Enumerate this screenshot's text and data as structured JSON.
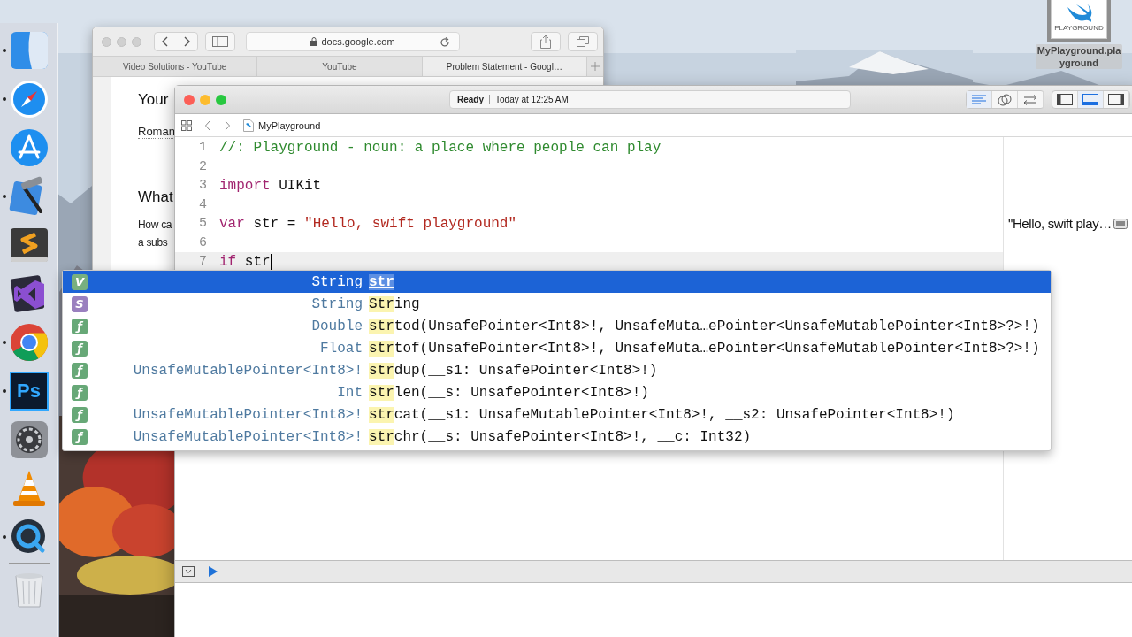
{
  "dock": {
    "items": [
      {
        "kind": "finder",
        "running": true
      },
      {
        "kind": "safari",
        "running": true
      },
      {
        "kind": "appstore",
        "running": false
      },
      {
        "kind": "xcode",
        "running": true
      },
      {
        "kind": "sublime",
        "running": false
      },
      {
        "kind": "vstudio",
        "running": false
      },
      {
        "kind": "chrome",
        "running": true
      },
      {
        "kind": "photoshop",
        "running": true,
        "glyph": "Ps"
      },
      {
        "kind": "preferences",
        "running": false
      },
      {
        "kind": "vlc",
        "running": false
      },
      {
        "kind": "quicktime",
        "running": true
      },
      {
        "kind": "trash",
        "running": false
      }
    ]
  },
  "desktop_file": {
    "badge": "PLAYGROUND",
    "name": "MyPlayground.playground"
  },
  "browser": {
    "url": "docs.google.com",
    "tabs": [
      {
        "label": "Video Solutions - YouTube",
        "selected": false
      },
      {
        "label": "YouTube",
        "selected": false
      },
      {
        "label": "Problem Statement - Googl…",
        "selected": true
      }
    ],
    "page": [
      {
        "kind": "heading",
        "text": "Your"
      },
      {
        "kind": "link",
        "text": "Roman"
      },
      {
        "kind": "heading",
        "text": "What"
      },
      {
        "kind": "para",
        "text": "How ca"
      },
      {
        "kind": "para",
        "text": "a subs"
      }
    ]
  },
  "xcode": {
    "status": "Ready",
    "time": "Today at 12:25 AM",
    "editor_buttons": [
      {
        "kind": "lines",
        "selected": true
      },
      {
        "kind": "circles",
        "selected": false
      },
      {
        "kind": "arrows",
        "selected": false
      }
    ],
    "panel_buttons": [
      {
        "kind": "left",
        "selected": false
      },
      {
        "kind": "bottom",
        "selected": true
      },
      {
        "kind": "right",
        "selected": false
      }
    ],
    "breadcrumb": "MyPlayground",
    "lines": [
      {
        "number": "1",
        "current": false,
        "tokens": [
          {
            "kind": "comment",
            "text": "//: Playground - noun: a place where people can play"
          }
        ]
      },
      {
        "number": "2",
        "current": false
      },
      {
        "number": "3",
        "current": false,
        "tokens": [
          {
            "kind": "keyword",
            "text": "import"
          },
          {
            "kind": "plain",
            "text": " UIKit"
          }
        ]
      },
      {
        "number": "4",
        "current": false
      },
      {
        "number": "5",
        "current": false,
        "tokens": [
          {
            "kind": "keyword",
            "text": "var"
          },
          {
            "kind": "plain",
            "text": " str = "
          },
          {
            "kind": "string",
            "text": "\"Hello, swift playground\""
          }
        ],
        "result": "\"Hello, swift play…"
      },
      {
        "number": "6",
        "current": false
      },
      {
        "number": "7",
        "current": true,
        "tokens": [
          {
            "kind": "keyword",
            "text": "if"
          },
          {
            "kind": "plain",
            "text": " str"
          }
        ]
      }
    ],
    "completions": [
      {
        "letter": "V",
        "color": "#78b07f",
        "type": "String",
        "name": "**str**",
        "selected": true
      },
      {
        "letter": "S",
        "color": "#9a80bf",
        "type": "String",
        "name": "**Str**ing",
        "selected": false
      },
      {
        "letter": "ƒ",
        "color": "#67a877",
        "type": "Double",
        "name": "**str**tod(UnsafePointer<Int8>!, UnsafeMuta…ePointer<UnsafeMutablePointer<Int8>?>!)",
        "selected": false
      },
      {
        "letter": "ƒ",
        "color": "#67a877",
        "type": "Float",
        "name": "**str**tof(UnsafePointer<Int8>!, UnsafeMuta…ePointer<UnsafeMutablePointer<Int8>?>!)",
        "selected": false
      },
      {
        "letter": "ƒ",
        "color": "#67a877",
        "type": "UnsafeMutablePointer<Int8>!",
        "name": "**str**dup(__s1: UnsafePointer<Int8>!)",
        "selected": false
      },
      {
        "letter": "ƒ",
        "color": "#67a877",
        "type": "Int",
        "name": "**str**len(__s: UnsafePointer<Int8>!)",
        "selected": false
      },
      {
        "letter": "ƒ",
        "color": "#67a877",
        "type": "UnsafeMutablePointer<Int8>!",
        "name": "**str**cat(__s1: UnsafeMutablePointer<Int8>!, __s2: UnsafePointer<Int8>!)",
        "selected": false
      },
      {
        "letter": "ƒ",
        "color": "#67a877",
        "type": "UnsafeMutablePointer<Int8>!",
        "name": "**str**chr(__s: UnsafePointer<Int8>!, __c: Int32)",
        "selected": false
      }
    ]
  }
}
